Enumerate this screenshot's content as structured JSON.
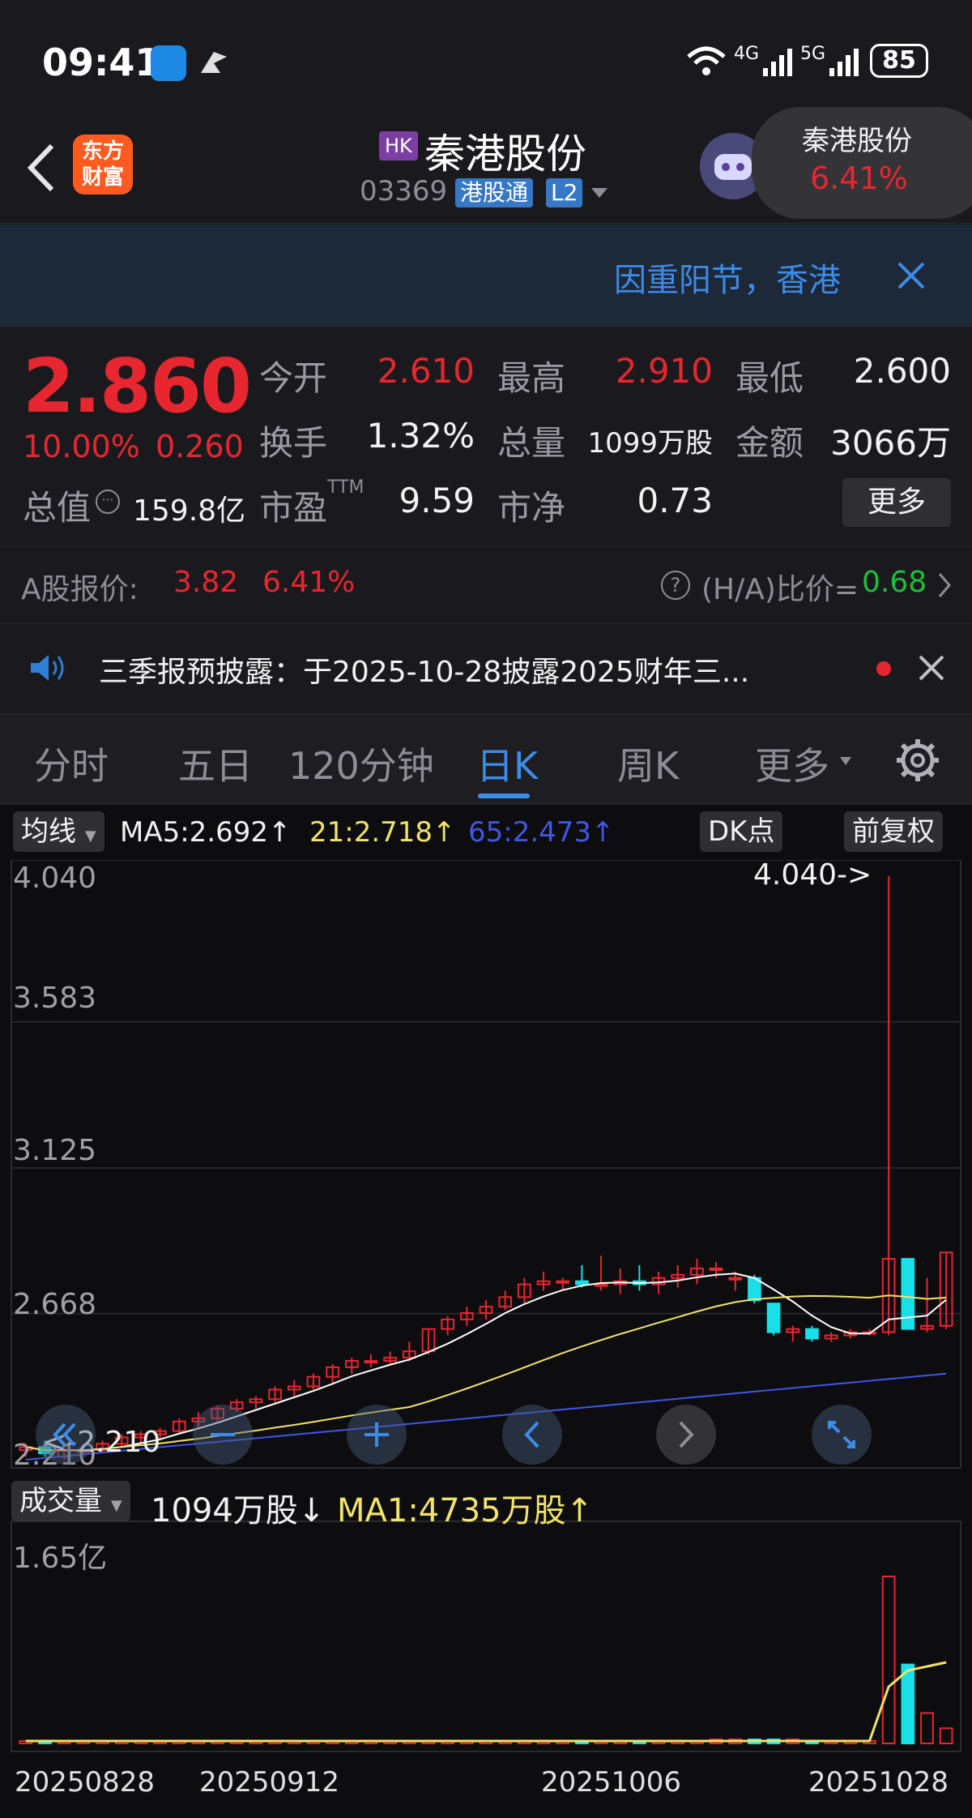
{
  "status": {
    "time": "09:41",
    "network_4g": "4G",
    "network_5g": "5G",
    "battery": "85"
  },
  "header": {
    "logo_line1": "东方",
    "logo_line2": "财富",
    "market_tag": "HK",
    "stock_name": "秦港股份",
    "stock_code": "03369",
    "tag_connect": "港股通",
    "tag_level": "L2",
    "popup_name": "秦港股份",
    "popup_pct": "6.41%"
  },
  "banner": {
    "text": "因重阳节，香港"
  },
  "quote": {
    "price": "2.860",
    "change_pct": "10.00%",
    "change_abs": "0.260",
    "cap_label": "总值",
    "cap_value": "159.8亿",
    "open_label": "今开",
    "open_value": "2.610",
    "high_label": "最高",
    "high_value": "2.910",
    "low_label": "最低",
    "low_value": "2.600",
    "turnover_label": "换手",
    "turnover_value": "1.32%",
    "volume_label": "总量",
    "volume_value": "1099万股",
    "amount_label": "金额",
    "amount_value": "3066万",
    "pe_label": "市盈",
    "pe_sup": "TTM",
    "pe_value": "9.59",
    "pb_label": "市净",
    "pb_value": "0.73",
    "more_label": "更多"
  },
  "ashare": {
    "label": "A股报价:",
    "price": "3.82",
    "pct": "6.41%",
    "ratio_label": "(H/A)比价=",
    "ratio_value": "0.68"
  },
  "news": {
    "text": "三季报预披露：于2025-10-28披露2025财年三..."
  },
  "tabs": [
    "分时",
    "五日",
    "120分钟",
    "日K",
    "周K",
    "更多"
  ],
  "active_tab": 3,
  "kline": {
    "ma_selector": "均线",
    "ma5": "MA5:2.692↑",
    "ma21": "21:2.718↑",
    "ma65": "65:2.473↑",
    "dk_button": "DK点",
    "adjust_button": "前复权",
    "y_ticks": [
      "4.040",
      "3.583",
      "3.125",
      "2.668",
      "2.210"
    ],
    "max_marker": "4.040->",
    "min_marker": "<-2.210"
  },
  "volume": {
    "selector": "成交量",
    "current": "1094万股↓",
    "ma1": "MA1:4735万股↑",
    "y_max": "1.65亿"
  },
  "dates": [
    "20250828",
    "20250912",
    "20251006",
    "20251028"
  ],
  "colors": {
    "up": "#e8262f",
    "down": "#19e0e8",
    "ma5": "#ffffff",
    "ma21": "#f2e36b",
    "ma65": "#3f56e8",
    "accent": "#3c8ce8"
  },
  "chart_data": {
    "type": "candlestick",
    "ylim": [
      2.21,
      4.04
    ],
    "ohlc": [
      [
        2.24,
        2.26,
        2.22,
        2.25
      ],
      [
        2.25,
        2.27,
        2.22,
        2.23
      ],
      [
        2.22,
        2.25,
        2.21,
        2.24
      ],
      [
        2.24,
        2.26,
        2.23,
        2.24
      ],
      [
        2.24,
        2.27,
        2.23,
        2.26
      ],
      [
        2.26,
        2.29,
        2.25,
        2.28
      ],
      [
        2.28,
        2.3,
        2.26,
        2.29
      ],
      [
        2.29,
        2.31,
        2.27,
        2.3
      ],
      [
        2.3,
        2.34,
        2.29,
        2.33
      ],
      [
        2.33,
        2.36,
        2.31,
        2.34
      ],
      [
        2.34,
        2.38,
        2.33,
        2.37
      ],
      [
        2.37,
        2.4,
        2.36,
        2.39
      ],
      [
        2.39,
        2.41,
        2.37,
        2.4
      ],
      [
        2.4,
        2.44,
        2.39,
        2.43
      ],
      [
        2.43,
        2.46,
        2.41,
        2.44
      ],
      [
        2.44,
        2.48,
        2.43,
        2.47
      ],
      [
        2.47,
        2.51,
        2.45,
        2.5
      ],
      [
        2.5,
        2.53,
        2.48,
        2.52
      ],
      [
        2.52,
        2.54,
        2.5,
        2.52
      ],
      [
        2.52,
        2.55,
        2.51,
        2.53
      ],
      [
        2.53,
        2.58,
        2.52,
        2.55
      ],
      [
        2.55,
        2.62,
        2.54,
        2.62
      ],
      [
        2.62,
        2.66,
        2.6,
        2.65
      ],
      [
        2.65,
        2.69,
        2.63,
        2.67
      ],
      [
        2.67,
        2.71,
        2.65,
        2.69
      ],
      [
        2.69,
        2.74,
        2.68,
        2.72
      ],
      [
        2.72,
        2.78,
        2.7,
        2.76
      ],
      [
        2.76,
        2.8,
        2.74,
        2.77
      ],
      [
        2.77,
        2.78,
        2.74,
        2.77
      ],
      [
        2.77,
        2.82,
        2.75,
        2.76
      ],
      [
        2.76,
        2.85,
        2.74,
        2.76
      ],
      [
        2.76,
        2.81,
        2.73,
        2.77
      ],
      [
        2.77,
        2.82,
        2.74,
        2.76
      ],
      [
        2.76,
        2.8,
        2.73,
        2.78
      ],
      [
        2.78,
        2.82,
        2.75,
        2.79
      ],
      [
        2.79,
        2.84,
        2.76,
        2.81
      ],
      [
        2.81,
        2.83,
        2.78,
        2.81
      ],
      [
        2.78,
        2.8,
        2.74,
        2.78
      ],
      [
        2.78,
        2.79,
        2.7,
        2.71
      ],
      [
        2.7,
        2.7,
        2.6,
        2.61
      ],
      [
        2.61,
        2.63,
        2.58,
        2.62
      ],
      [
        2.62,
        2.63,
        2.58,
        2.59
      ],
      [
        2.59,
        2.61,
        2.58,
        2.6
      ],
      [
        2.6,
        2.62,
        2.59,
        2.61
      ],
      [
        2.61,
        2.62,
        2.6,
        2.61
      ],
      [
        2.61,
        4.04,
        2.6,
        2.84
      ],
      [
        2.84,
        2.84,
        2.62,
        2.62
      ],
      [
        2.62,
        2.78,
        2.61,
        2.63
      ],
      [
        2.63,
        2.86,
        2.62,
        2.86
      ]
    ],
    "volume_max": 165000000
  }
}
